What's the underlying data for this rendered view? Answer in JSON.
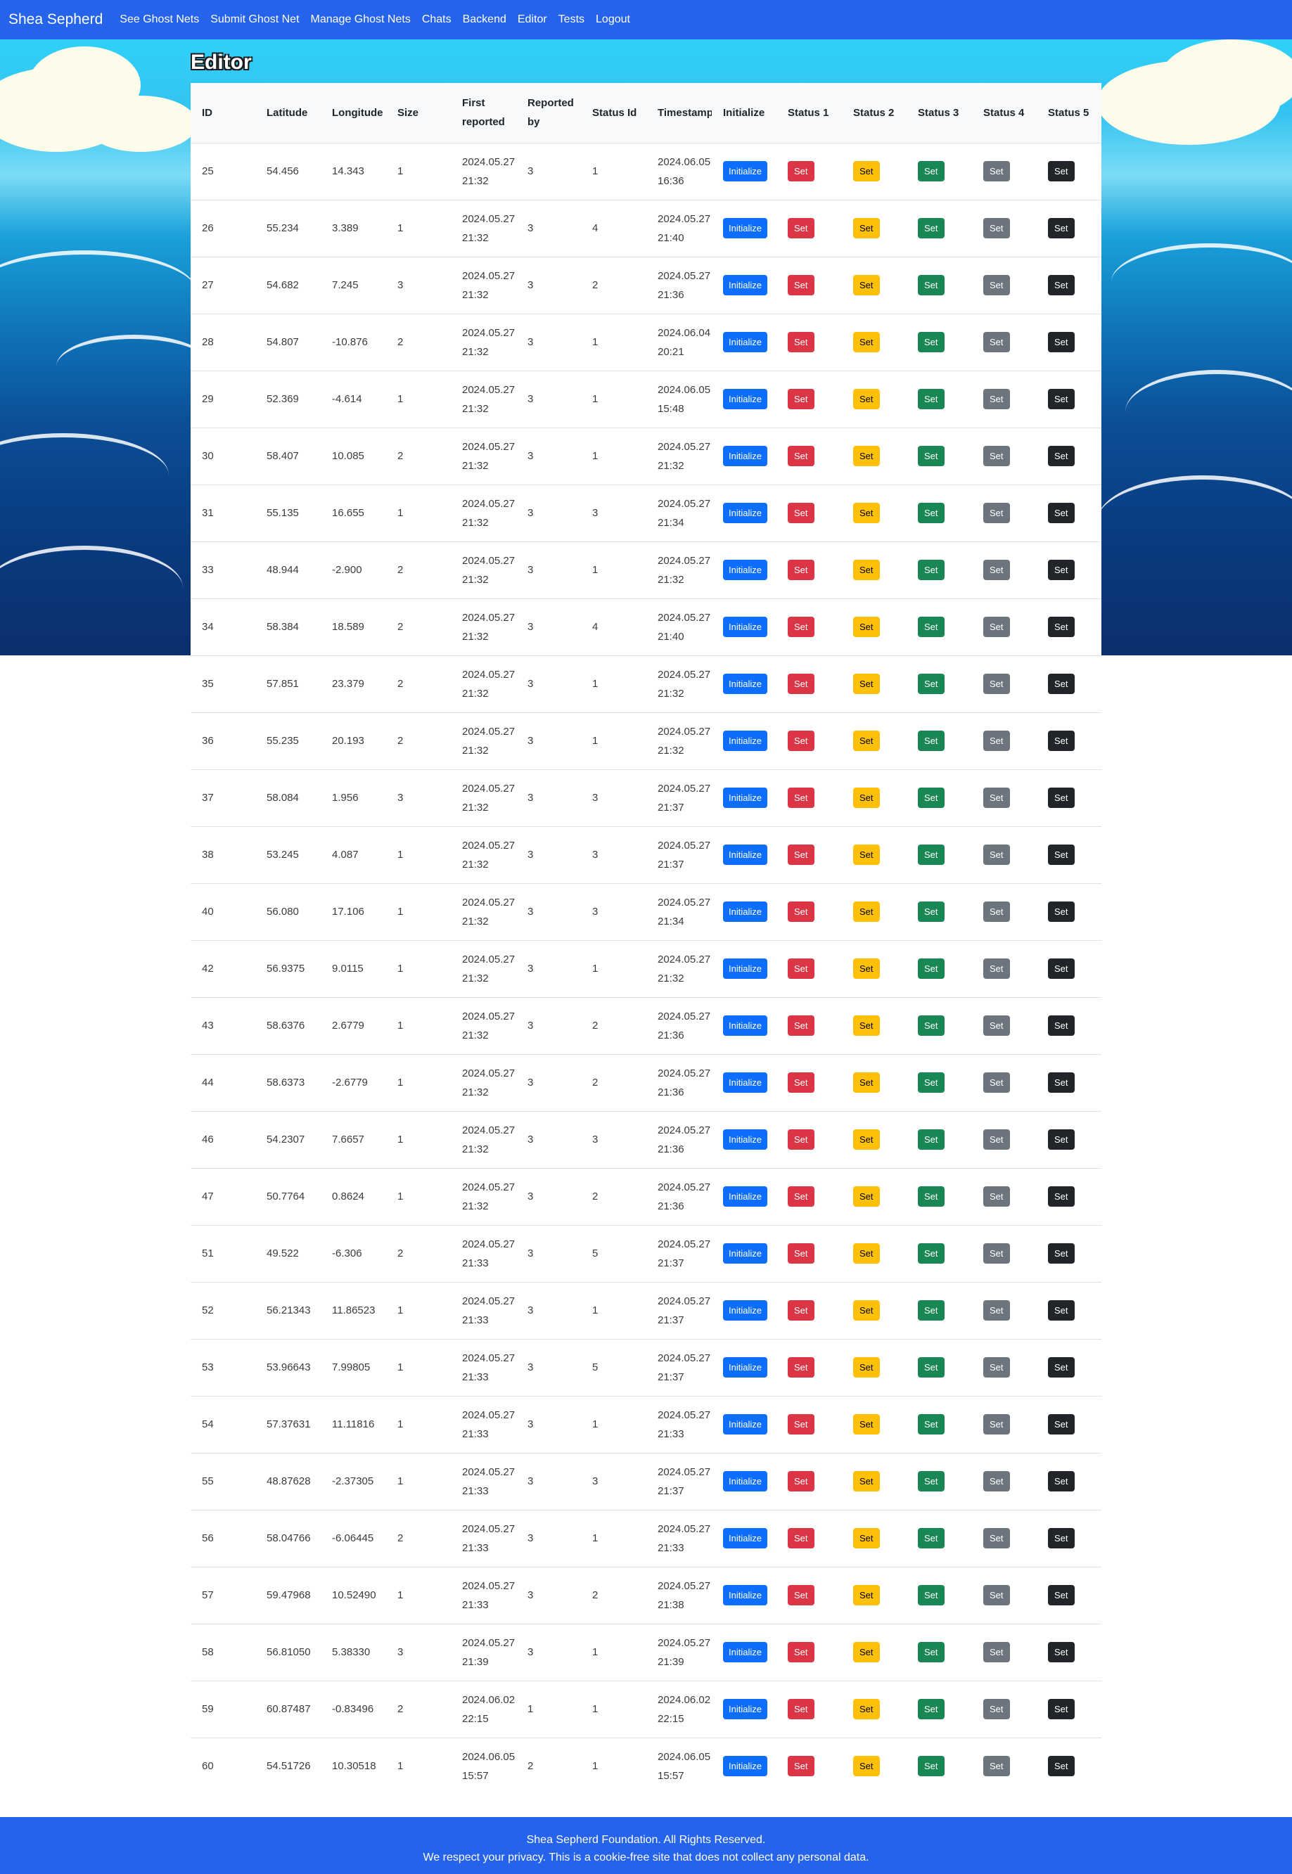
{
  "navbar": {
    "brand": "Shea Sepherd",
    "links": [
      "See Ghost Nets",
      "Submit Ghost Net",
      "Manage Ghost Nets",
      "Chats",
      "Backend",
      "Editor",
      "Tests",
      "Logout"
    ]
  },
  "page": {
    "title": "Editor"
  },
  "table": {
    "headers": [
      "ID",
      "Latitude",
      "Longitude",
      "Size",
      "First reported",
      "Reported by",
      "Status Id",
      "Timestamp",
      "Initialize",
      "Status 1",
      "Status 2",
      "Status 3",
      "Status 4",
      "Status 5"
    ],
    "button_labels": {
      "initialize": "Initialize",
      "set": "Set"
    },
    "rows": [
      [
        "25",
        "54.456",
        "14.343",
        "1",
        "2024.05.27 21:32",
        "3",
        "1",
        "2024.06.05 16:36"
      ],
      [
        "26",
        "55.234",
        "3.389",
        "1",
        "2024.05.27 21:32",
        "3",
        "4",
        "2024.05.27 21:40"
      ],
      [
        "27",
        "54.682",
        "7.245",
        "3",
        "2024.05.27 21:32",
        "3",
        "2",
        "2024.05.27 21:36"
      ],
      [
        "28",
        "54.807",
        "-10.876",
        "2",
        "2024.05.27 21:32",
        "3",
        "1",
        "2024.06.04 20:21"
      ],
      [
        "29",
        "52.369",
        "-4.614",
        "1",
        "2024.05.27 21:32",
        "3",
        "1",
        "2024.06.05 15:48"
      ],
      [
        "30",
        "58.407",
        "10.085",
        "2",
        "2024.05.27 21:32",
        "3",
        "1",
        "2024.05.27 21:32"
      ],
      [
        "31",
        "55.135",
        "16.655",
        "1",
        "2024.05.27 21:32",
        "3",
        "3",
        "2024.05.27 21:34"
      ],
      [
        "33",
        "48.944",
        "-2.900",
        "2",
        "2024.05.27 21:32",
        "3",
        "1",
        "2024.05.27 21:32"
      ],
      [
        "34",
        "58.384",
        "18.589",
        "2",
        "2024.05.27 21:32",
        "3",
        "4",
        "2024.05.27 21:40"
      ],
      [
        "35",
        "57.851",
        "23.379",
        "2",
        "2024.05.27 21:32",
        "3",
        "1",
        "2024.05.27 21:32"
      ],
      [
        "36",
        "55.235",
        "20.193",
        "2",
        "2024.05.27 21:32",
        "3",
        "1",
        "2024.05.27 21:32"
      ],
      [
        "37",
        "58.084",
        "1.956",
        "3",
        "2024.05.27 21:32",
        "3",
        "3",
        "2024.05.27 21:37"
      ],
      [
        "38",
        "53.245",
        "4.087",
        "1",
        "2024.05.27 21:32",
        "3",
        "3",
        "2024.05.27 21:37"
      ],
      [
        "40",
        "56.080",
        "17.106",
        "1",
        "2024.05.27 21:32",
        "3",
        "3",
        "2024.05.27 21:34"
      ],
      [
        "42",
        "56.9375",
        "9.0115",
        "1",
        "2024.05.27 21:32",
        "3",
        "1",
        "2024.05.27 21:32"
      ],
      [
        "43",
        "58.6376",
        "2.6779",
        "1",
        "2024.05.27 21:32",
        "3",
        "2",
        "2024.05.27 21:36"
      ],
      [
        "44",
        "58.6373",
        "-2.6779",
        "1",
        "2024.05.27 21:32",
        "3",
        "2",
        "2024.05.27 21:36"
      ],
      [
        "46",
        "54.2307",
        "7.6657",
        "1",
        "2024.05.27 21:32",
        "3",
        "3",
        "2024.05.27 21:36"
      ],
      [
        "47",
        "50.7764",
        "0.8624",
        "1",
        "2024.05.27 21:32",
        "3",
        "2",
        "2024.05.27 21:36"
      ],
      [
        "51",
        "49.522",
        "-6.306",
        "2",
        "2024.05.27 21:33",
        "3",
        "5",
        "2024.05.27 21:37"
      ],
      [
        "52",
        "56.21343",
        "11.86523",
        "1",
        "2024.05.27 21:33",
        "3",
        "1",
        "2024.05.27 21:37"
      ],
      [
        "53",
        "53.96643",
        "7.99805",
        "1",
        "2024.05.27 21:33",
        "3",
        "5",
        "2024.05.27 21:37"
      ],
      [
        "54",
        "57.37631",
        "11.11816",
        "1",
        "2024.05.27 21:33",
        "3",
        "1",
        "2024.05.27 21:33"
      ],
      [
        "55",
        "48.87628",
        "-2.37305",
        "1",
        "2024.05.27 21:33",
        "3",
        "3",
        "2024.05.27 21:37"
      ],
      [
        "56",
        "58.04766",
        "-6.06445",
        "2",
        "2024.05.27 21:33",
        "3",
        "1",
        "2024.05.27 21:33"
      ],
      [
        "57",
        "59.47968",
        "10.52490",
        "1",
        "2024.05.27 21:33",
        "3",
        "2",
        "2024.05.27 21:38"
      ],
      [
        "58",
        "56.81050",
        "5.38330",
        "3",
        "2024.05.27 21:39",
        "3",
        "1",
        "2024.05.27 21:39"
      ],
      [
        "59",
        "60.87487",
        "-0.83496",
        "2",
        "2024.06.02 22:15",
        "1",
        "1",
        "2024.06.02 22:15"
      ],
      [
        "60",
        "54.51726",
        "10.30518",
        "1",
        "2024.06.05 15:57",
        "2",
        "1",
        "2024.06.05 15:57"
      ]
    ]
  },
  "footer": {
    "line1": "Shea Sepherd Foundation. All Rights Reserved.",
    "line2": "We respect your privacy. This is a cookie-free site that does not collect any personal data."
  },
  "colors": {
    "navbar": "#2563eb",
    "initialize": "#0d6efd",
    "status1": "#dc3545",
    "status2": "#ffc107",
    "status3": "#198754",
    "status4": "#6c757d",
    "status5": "#212529"
  }
}
